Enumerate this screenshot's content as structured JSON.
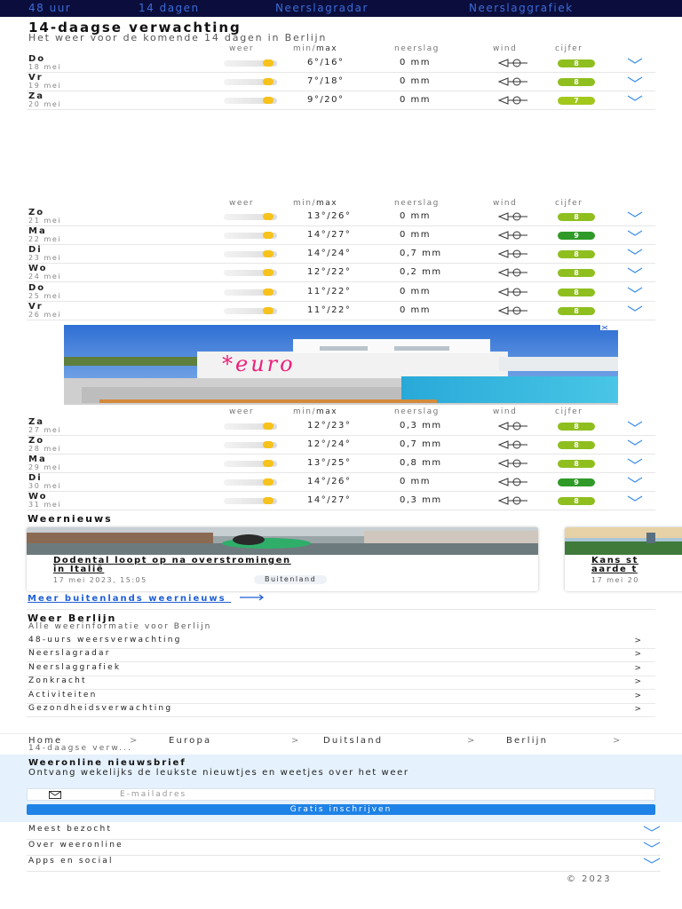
{
  "topnav": {
    "items": [
      "48 uur",
      "14 dagen",
      "Neerslagradar",
      "Neerslaggrafiek"
    ]
  },
  "header": {
    "title": "14-daagse verwachting",
    "subtitle": "Het weer voor de komende 14 dagen in Berlijn"
  },
  "columns": {
    "weer": "weer",
    "min": "min/",
    "max": "max",
    "neerslag": "neerslag",
    "wind": "wind",
    "cijfer": "cijfer"
  },
  "forecast": [
    {
      "day": "Do",
      "date": "18 mei",
      "temp": "6°/16°",
      "rain": "0 mm",
      "score": "8",
      "score_color": "#8fbf1f"
    },
    {
      "day": "Vr",
      "date": "19 mei",
      "temp": "7°/18°",
      "rain": "0 mm",
      "score": "8",
      "score_color": "#8fbf1f"
    },
    {
      "day": "Za",
      "date": "20 mei",
      "temp": "9°/20°",
      "rain": "0 mm",
      "score": "7",
      "score_color": "#a2c81c"
    },
    {
      "day": "Zo",
      "date": "21 mei",
      "temp": "13°/26°",
      "rain": "0 mm",
      "score": "8",
      "score_color": "#8fbf1f"
    },
    {
      "day": "Ma",
      "date": "22 mei",
      "temp": "14°/27°",
      "rain": "0 mm",
      "score": "9",
      "score_color": "#2f9a28"
    },
    {
      "day": "Di",
      "date": "23 mei",
      "temp": "14°/24°",
      "rain": "0,7 mm",
      "score": "8",
      "score_color": "#8fbf1f"
    },
    {
      "day": "Wo",
      "date": "24 mei",
      "temp": "12°/22°",
      "rain": "0,2 mm",
      "score": "8",
      "score_color": "#8fbf1f"
    },
    {
      "day": "Do",
      "date": "25 mei",
      "temp": "11°/22°",
      "rain": "0 mm",
      "score": "8",
      "score_color": "#8fbf1f"
    },
    {
      "day": "Vr",
      "date": "26 mei",
      "temp": "11°/22°",
      "rain": "0 mm",
      "score": "8",
      "score_color": "#8fbf1f"
    },
    {
      "day": "Za",
      "date": "27 mei",
      "temp": "12°/23°",
      "rain": "0,3 mm",
      "score": "8",
      "score_color": "#8fbf1f"
    },
    {
      "day": "Zo",
      "date": "28 mei",
      "temp": "12°/24°",
      "rain": "0,7 mm",
      "score": "8",
      "score_color": "#8fbf1f"
    },
    {
      "day": "Ma",
      "date": "29 mei",
      "temp": "13°/25°",
      "rain": "0,8 mm",
      "score": "8",
      "score_color": "#8fbf1f"
    },
    {
      "day": "Di",
      "date": "30 mei",
      "temp": "14°/26°",
      "rain": "0 mm",
      "score": "9",
      "score_color": "#2f9a28"
    },
    {
      "day": "Wo",
      "date": "31 mei",
      "temp": "14°/27°",
      "rain": "0,3 mm",
      "score": "8",
      "score_color": "#8fbf1f"
    }
  ],
  "ad": {
    "brand": "*euro"
  },
  "news": {
    "section_title": "Weernieuws",
    "cards": [
      {
        "title_line1": "Dodental loopt op na overstromingen",
        "title_line2": "in Italië",
        "date": "17 mei 2023, 15:05",
        "tag": "Buitenland"
      },
      {
        "title_line1": "Kans st",
        "title_line2": "aarde t",
        "date": "17 mei 20"
      }
    ],
    "more_link": "Meer buitenlands weernieuws"
  },
  "weer_berlijn": {
    "title": "Weer Berlijn",
    "subtitle": "Alle weerinformatie voor Berlijn",
    "links": [
      "48-uurs weersverwachting",
      "Neerslagradar",
      "Neerslaggrafiek",
      "Zonkracht",
      "Activiteiten",
      "Gezondheidsverwachting"
    ],
    "chevron": ">"
  },
  "breadcrumb": {
    "items": [
      "Home",
      "Europa",
      "Duitsland",
      "Berlijn"
    ],
    "separator": ">",
    "current": "14-daagse verw..."
  },
  "newsletter": {
    "title": "Weeronline nieuwsbrief",
    "text": "Ontvang wekelijks de leukste nieuwtjes en weetjes over het weer",
    "placeholder": "E-mailadres",
    "button": "Gratis inschrijven"
  },
  "footer": {
    "items": [
      "Meest bezocht",
      "Over weeronline",
      "Apps en social"
    ],
    "copyright": "© 2023"
  },
  "colors": {
    "nav_bg": "#0b0e3c",
    "link_blue": "#1e5fd6",
    "button_blue": "#1e82e6",
    "newsletter_bg": "#e5f1fc"
  }
}
